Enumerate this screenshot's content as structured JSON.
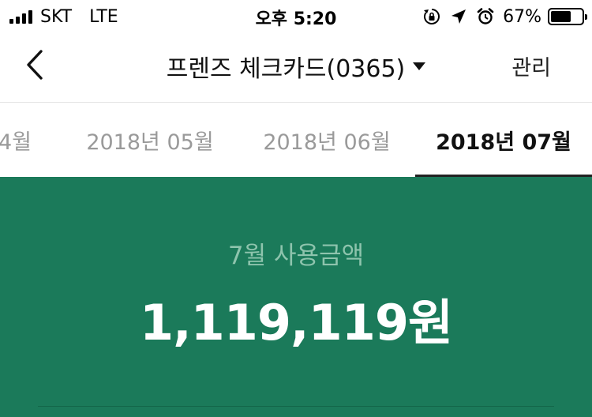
{
  "status_bar": {
    "carrier": "SKT",
    "network": "LTE",
    "time": "오후 5:20",
    "battery_percent_text": "67%",
    "battery_level": 0.67,
    "icons": [
      "rotation-lock-icon",
      "location-arrow-icon",
      "alarm-icon"
    ]
  },
  "nav": {
    "title": "프렌즈 체크카드(0365)",
    "manage_label": "관리"
  },
  "month_tabs": [
    {
      "label": "4월",
      "active": false
    },
    {
      "label": "2018년 05월",
      "active": false
    },
    {
      "label": "2018년 06월",
      "active": false
    },
    {
      "label": "2018년 07월",
      "active": true
    }
  ],
  "summary": {
    "label": "7월 사용금액",
    "amount": "1,119,119원",
    "background_color": "#1b7a5a"
  }
}
